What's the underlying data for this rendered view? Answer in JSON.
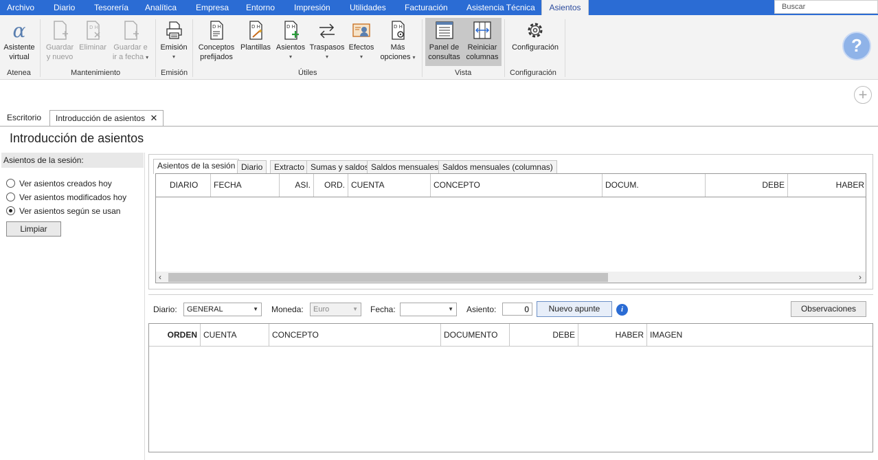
{
  "menu": {
    "items": [
      "Archivo",
      "Diario",
      "Tesorería",
      "Analítica",
      "Empresa",
      "Entorno",
      "Impresión",
      "Utilidades",
      "Facturación",
      "Asistencia Técnica",
      "Asientos"
    ],
    "active": "Asientos"
  },
  "search": {
    "placeholder": "Buscar"
  },
  "ribbon": {
    "groups": {
      "atenea": "Atenea",
      "mantenimiento": "Mantenimiento",
      "emision": "Emisión",
      "utiles": "Útiles",
      "vista": "Vista",
      "configuracion": "Configuración"
    },
    "buttons": {
      "asistente": [
        "Asistente",
        "virtual"
      ],
      "guardar_nuevo": [
        "Guardar",
        "y nuevo"
      ],
      "eliminar": [
        "Eliminar"
      ],
      "guardar_fecha": [
        "Guardar e",
        "ir a fecha"
      ],
      "emision": [
        "Emisión"
      ],
      "conceptos": [
        "Conceptos",
        "prefijados"
      ],
      "plantillas": [
        "Plantillas"
      ],
      "asientos": [
        "Asientos"
      ],
      "traspasos": [
        "Traspasos"
      ],
      "efectos": [
        "Efectos"
      ],
      "mas_opciones": [
        "Más",
        "opciones"
      ],
      "panel_consultas": [
        "Panel de",
        "consultas"
      ],
      "reiniciar_columnas": [
        "Reiniciar",
        "columnas"
      ],
      "configuracion": [
        "Configuración"
      ]
    }
  },
  "doc_tabs": {
    "escritorio": "Escritorio",
    "introduccion": "Introducción de asientos"
  },
  "page_title": "Introducción de asientos",
  "session": {
    "header": "Asientos de la sesión:",
    "options": [
      "Ver asientos creados hoy",
      "Ver asientos modificados hoy",
      "Ver asientos según se usan"
    ],
    "selected_index": 2,
    "clear_button": "Limpiar"
  },
  "inner_tabs": [
    "Asientos de la sesión",
    "Diario",
    "Extracto",
    "Sumas y saldos",
    "Saldos mensuales",
    "Saldos mensuales (columnas)"
  ],
  "grid1": {
    "columns": [
      "DIARIO",
      "FECHA",
      "ASI.",
      "ORD.",
      "CUENTA",
      "CONCEPTO",
      "DOCUM.",
      "DEBE",
      "HABER"
    ]
  },
  "entry": {
    "diario_label": "Diario:",
    "diario_value": "GENERAL",
    "moneda_label": "Moneda:",
    "moneda_value": "Euro",
    "fecha_label": "Fecha:",
    "fecha_value": "",
    "asiento_label": "Asiento:",
    "asiento_value": "0",
    "nuevo_apunte": "Nuevo apunte",
    "observaciones": "Observaciones"
  },
  "grid2": {
    "columns": [
      "ORDEN",
      "CUENTA",
      "CONCEPTO",
      "DOCUMENTO",
      "DEBE",
      "HABER",
      "IMAGEN"
    ]
  }
}
